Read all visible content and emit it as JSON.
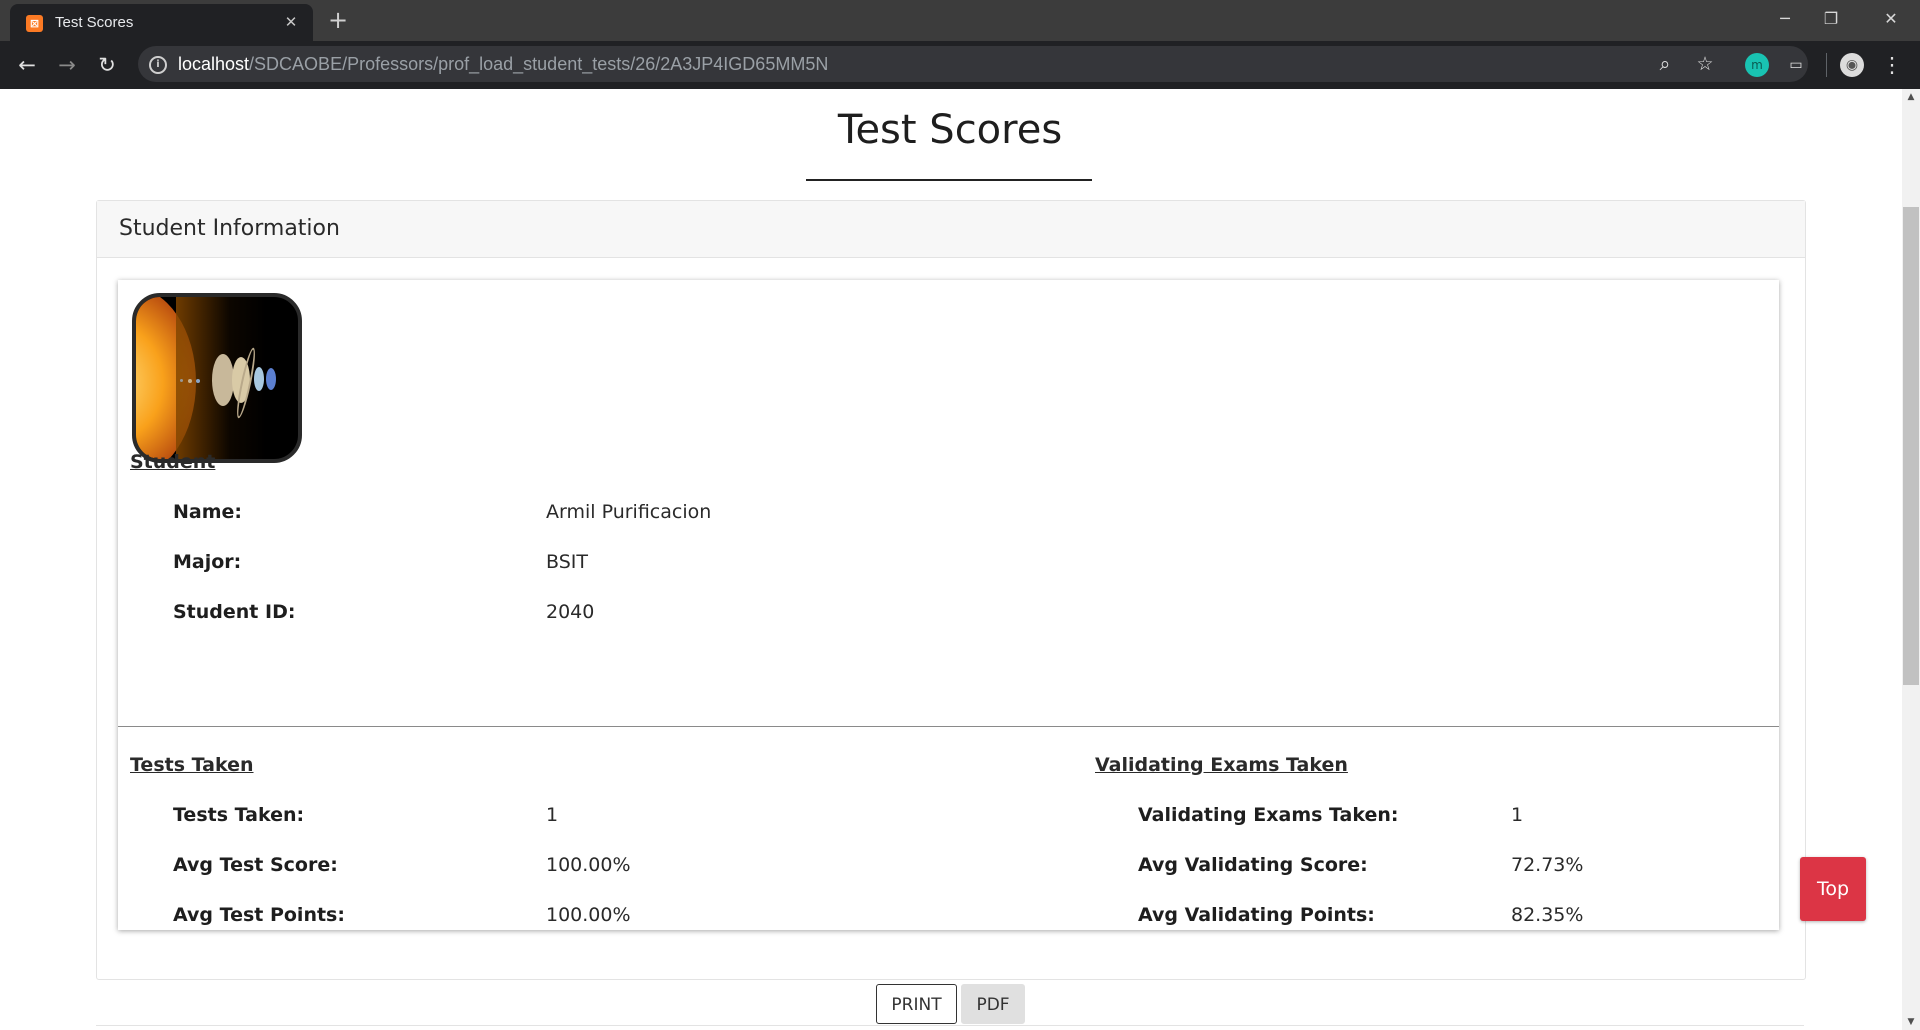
{
  "browser": {
    "tab_title": "Test Scores",
    "tab_icon": "xampp-favicon",
    "new_tab_symbol": "+",
    "url_host": "localhost",
    "url_path": "/SDCAOBE/Professors/prof_load_student_tests/26/2A3JP4IGD65MM5N"
  },
  "page": {
    "title": "Test Scores",
    "card_header": "Student Information",
    "student": {
      "section_title": "Student",
      "rows": [
        {
          "label": "Name:",
          "value": "Armil Purificacion"
        },
        {
          "label": "Major:",
          "value": "BSIT"
        },
        {
          "label": "Student ID:",
          "value": "2040"
        }
      ]
    },
    "tests": {
      "section_title": "Tests Taken",
      "rows": [
        {
          "label": "Tests Taken:",
          "value": "1"
        },
        {
          "label": "Avg Test Score:",
          "value": "100.00%"
        },
        {
          "label": "Avg Test Points:",
          "value": "100.00%"
        }
      ]
    },
    "validating": {
      "section_title": "Validating Exams Taken",
      "rows": [
        {
          "label": "Validating Exams Taken:",
          "value": "1"
        },
        {
          "label": "Avg Validating Score:",
          "value": "72.73%"
        },
        {
          "label": "Avg Validating Points:",
          "value": "82.35%"
        }
      ]
    },
    "buttons": {
      "print": "PRINT",
      "pdf": "PDF",
      "top": "Top"
    }
  },
  "colors": {
    "top_button": "#dc3545",
    "favicon": "#fb7a24"
  }
}
